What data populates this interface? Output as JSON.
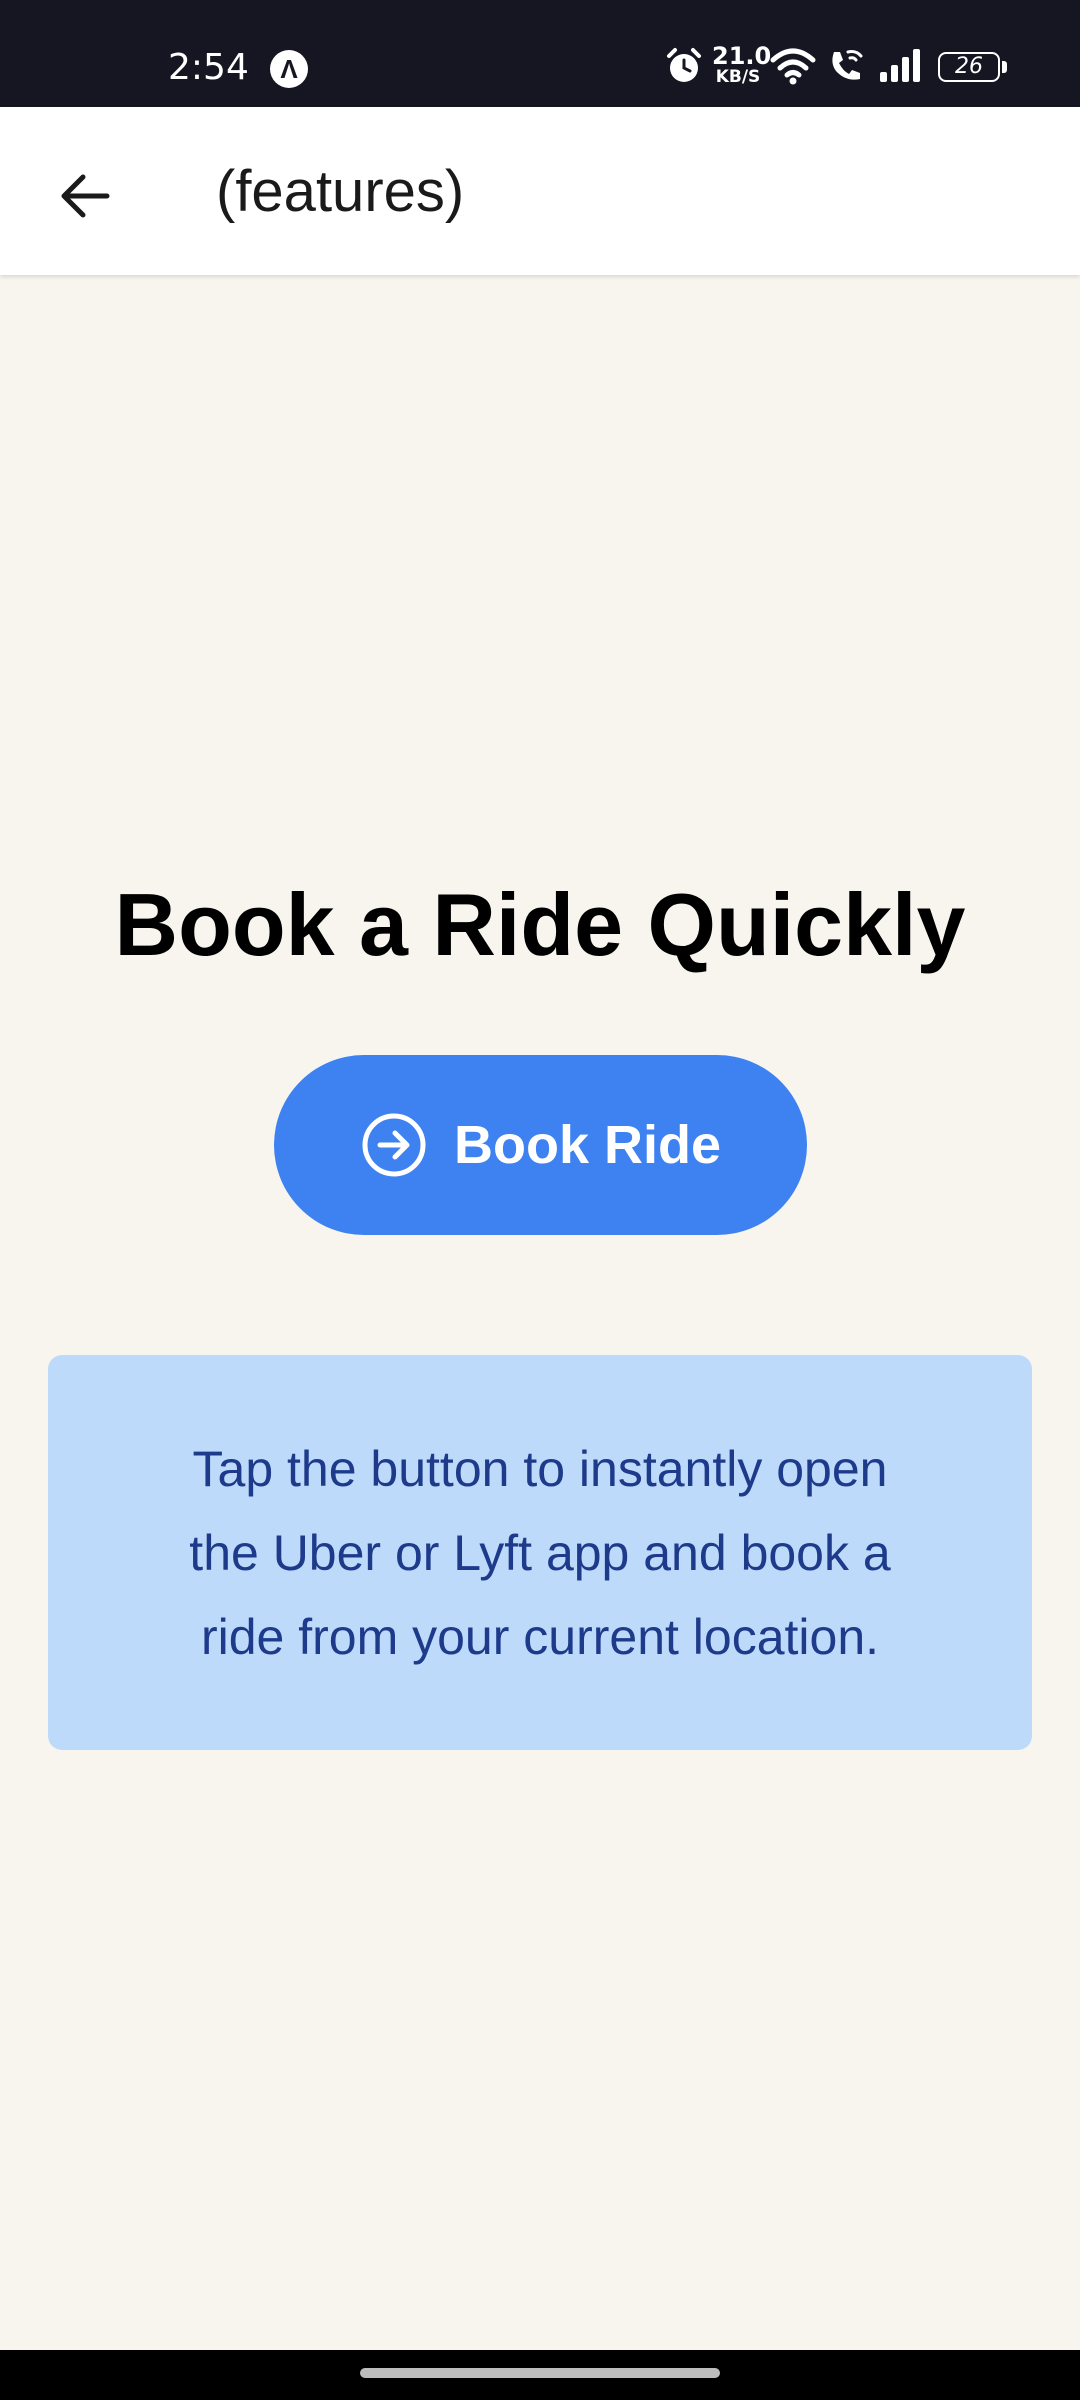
{
  "status_bar": {
    "time": "2:54",
    "app_badge": "Λ",
    "speed_value": "21.0",
    "speed_unit": "KB/S",
    "battery": "26",
    "icons": [
      "alarm-icon",
      "wifi-icon",
      "wifi-call-icon",
      "signal-icon",
      "battery-icon"
    ]
  },
  "header": {
    "back_icon": "arrow-left-icon",
    "title": "(features)"
  },
  "main": {
    "headline": "Book a Ride Quickly",
    "book_button": {
      "label": "Book Ride",
      "icon": "arrow-right-circle-icon"
    },
    "info_text": "Tap the button to instantly open the Uber or Lyft app and book a ride from your current location."
  },
  "colors": {
    "background": "#f8f5ef",
    "status_bar": "#151622",
    "accent": "#3d82f0",
    "info_bg": "#bedafb",
    "info_text": "#1e3a8a"
  }
}
